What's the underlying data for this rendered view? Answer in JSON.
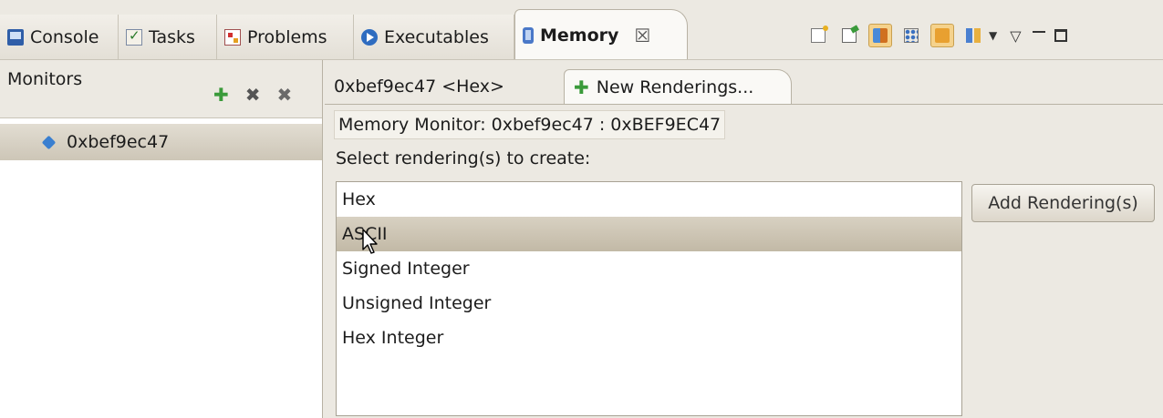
{
  "view_tabs": [
    {
      "label": "Console",
      "icon": "console-icon"
    },
    {
      "label": "Tasks",
      "icon": "tasks-icon"
    },
    {
      "label": "Problems",
      "icon": "problems-icon"
    },
    {
      "label": "Executables",
      "icon": "executables-icon"
    },
    {
      "label": "Memory",
      "icon": "memory-icon",
      "active": true
    }
  ],
  "tab_close_glyph": "☒",
  "toolbar": {
    "icons": [
      "new-monitor-icon",
      "pin-memory-icon",
      "link-rendering-icon",
      "toggle-grid-icon",
      "swap-rendering-icon",
      "rendering-columns-icon"
    ],
    "toggled_color": "#f5d28c"
  },
  "monitors": {
    "title": "Monitors",
    "add_glyph": "✚",
    "remove_glyph": "✖",
    "remove_all_glyph": "✖",
    "items": [
      {
        "label": "0xbef9ec47"
      }
    ]
  },
  "renderings": {
    "tabs": [
      "0xbef9ec47 <Hex>",
      "New Renderings..."
    ],
    "monitor_label": "Memory Monitor: 0xbef9ec47 : 0xBEF9EC47",
    "select_label": "Select rendering(s) to create:",
    "options": [
      "Hex",
      "ASCII",
      "Signed Integer",
      "Unsigned Integer",
      "Hex Integer"
    ],
    "selected_option": "ASCII",
    "add_button": "Add Rendering(s)"
  },
  "colors": {
    "panel_bg": "#ece9e2",
    "selection": "#c8bfae",
    "accent_blue": "#3a7fd0"
  }
}
